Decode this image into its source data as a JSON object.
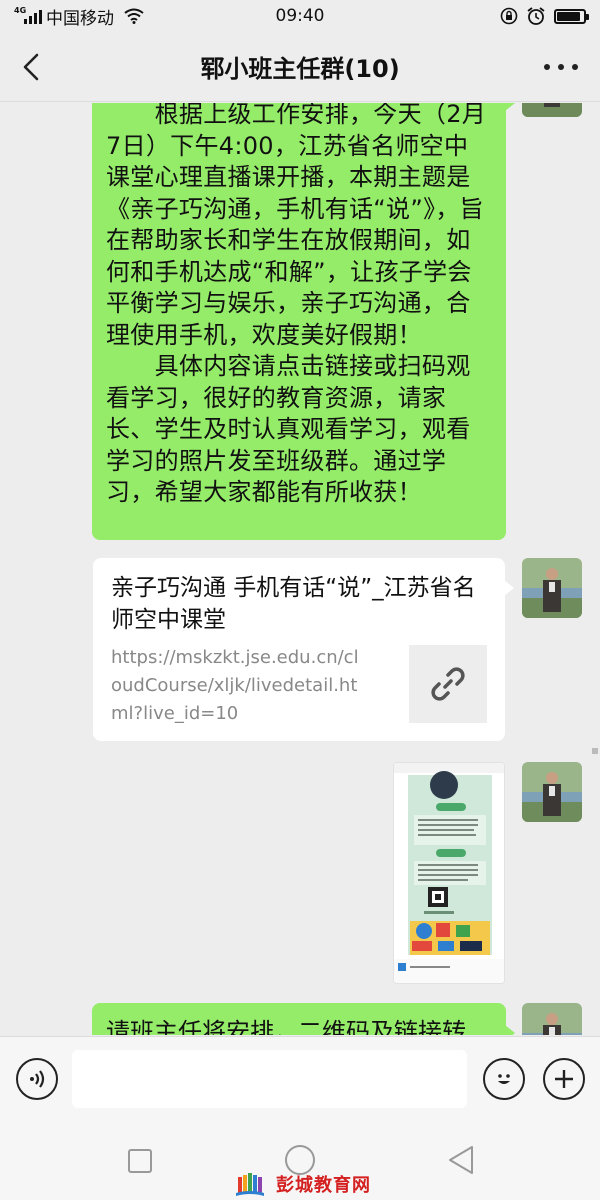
{
  "status_bar": {
    "network_type": "4G",
    "carrier": "中国移动",
    "time": "09:40",
    "battery_level": 0.9
  },
  "header": {
    "title": "郓小班主任群(10)"
  },
  "messages": {
    "notice_text": "　　根据上级工作安排，今天（2月7日）下午4:00，江苏省名师空中课堂心理直播课开播，本期主题是《亲子巧沟通，手机有话“说”》，旨在帮助家长和学生在放假期间，如何和手机达成“和解”，让孩子学会平衡学习与娱乐，亲子巧沟通，合理使用手机，欢度美好假期！\n　　具体内容请点击链接或扫码观看学习，很好的教育资源，请家长、学生及时认真观看学习，观看学习的照片发至班级群。通过学习，希望大家都能有所收获！",
    "link_card": {
      "title": "亲子巧沟通 手机有话“说”_江苏省名师空中课堂",
      "url": "https://mskzkt.jse.edu.cn/cloudCourse/xljk/livedetail.html?live_id=10",
      "thumb_icon": "link-icon"
    },
    "partial_text": "请班主任将安排，二维码及链接转"
  },
  "watermark": {
    "text": "彭城教育网"
  },
  "colors": {
    "self_bubble": "#95ec69",
    "background": "#ededed",
    "watermark_red": "#d42020"
  }
}
